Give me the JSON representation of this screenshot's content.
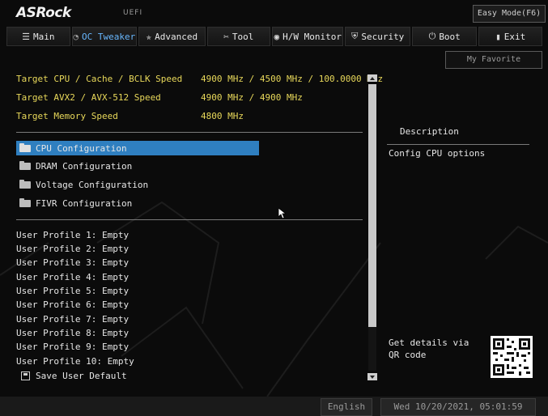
{
  "header": {
    "brand": "ASRock",
    "uefi_label": "UEFI",
    "easy_mode_label": "Easy Mode(F6)"
  },
  "tabs": [
    {
      "label": "Main",
      "icon": "list-icon",
      "active": false
    },
    {
      "label": "OC Tweaker",
      "icon": "gauge-icon",
      "active": true
    },
    {
      "label": "Advanced",
      "icon": "star-icon",
      "active": false
    },
    {
      "label": "Tool",
      "icon": "tools-icon",
      "active": false
    },
    {
      "label": "H/W Monitor",
      "icon": "monitor-icon",
      "active": false
    },
    {
      "label": "Security",
      "icon": "shield-icon",
      "active": false
    },
    {
      "label": "Boot",
      "icon": "power-icon",
      "active": false
    },
    {
      "label": "Exit",
      "icon": "exit-icon",
      "active": false
    }
  ],
  "favorite_label": "My Favorite",
  "info": [
    {
      "label": "Target CPU / Cache / BCLK Speed",
      "value": "4900 MHz / 4500 MHz / 100.0000 MHz"
    },
    {
      "label": "Target AVX2 / AVX-512 Speed",
      "value": "4900 MHz / 4900 MHz"
    },
    {
      "label": "Target Memory Speed",
      "value": "4800 MHz"
    }
  ],
  "menu": [
    {
      "label": "CPU Configuration",
      "selected": true
    },
    {
      "label": "DRAM Configuration",
      "selected": false
    },
    {
      "label": "Voltage Configuration",
      "selected": false
    },
    {
      "label": "FIVR Configuration",
      "selected": false
    }
  ],
  "profiles": [
    "User Profile 1: Empty",
    "User Profile 2: Empty",
    "User Profile 3: Empty",
    "User Profile 4: Empty",
    "User Profile 5: Empty",
    "User Profile 6: Empty",
    "User Profile 7: Empty",
    "User Profile 8: Empty",
    "User Profile 9: Empty",
    "User Profile 10: Empty"
  ],
  "save_default": "Save User Default",
  "description": {
    "heading": "Description",
    "text": "Config CPU options",
    "qr_text": "Get details via QR code"
  },
  "footer": {
    "language": "English",
    "datetime": "Wed 10/20/2021, 05:01:59"
  },
  "colors": {
    "accent": "#2f7fc0",
    "active_tab": "#69b8ff",
    "info_text": "#e8d85a"
  }
}
